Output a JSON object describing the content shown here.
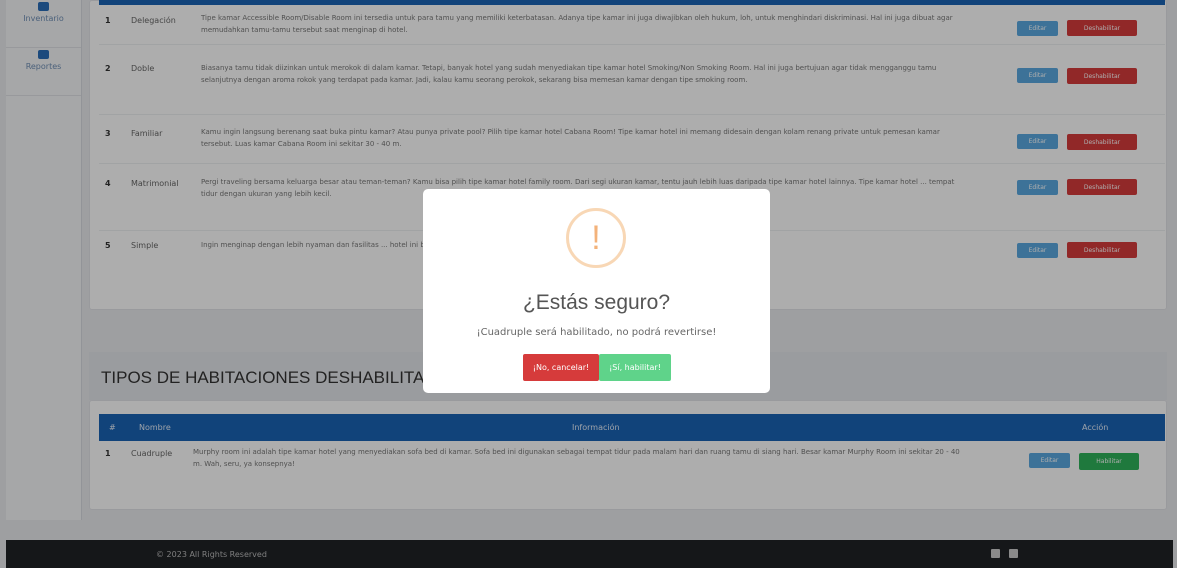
{
  "sidebar": {
    "items": [
      {
        "label": "Inventario",
        "icon": "box-icon"
      },
      {
        "label": "Reportes",
        "icon": "report-icon"
      }
    ]
  },
  "enabled_rooms": [
    {
      "num": "1",
      "name": "Delegación",
      "info": "Tipe kamar Accessible Room/Disable Room ini tersedia untuk para tamu yang memiliki keterbatasan. Adanya tipe kamar ini juga diwajibkan oleh hukum, loh, untuk menghindari diskriminasi. Hal ini juga dibuat agar memudahkan tamu-tamu tersebut saat menginap di hotel.",
      "edit": "Editar",
      "disable": "Deshabilitar"
    },
    {
      "num": "2",
      "name": "Doble",
      "info": "Biasanya tamu tidak diizinkan untuk merokok di dalam kamar. Tetapi, banyak hotel yang sudah menyediakan tipe kamar hotel Smoking/Non Smoking Room. Hal ini juga bertujuan agar tidak mengganggu tamu selanjutnya dengan aroma rokok yang terdapat pada kamar. Jadi, kalau kamu seorang perokok, sekarang bisa memesan kamar dengan tipe smoking room.",
      "edit": "Editar",
      "disable": "Deshabilitar"
    },
    {
      "num": "3",
      "name": "Familiar",
      "info": "Kamu ingin langsung berenang saat buka pintu kamar? Atau punya private pool? Pilih tipe kamar hotel Cabana Room! Tipe kamar hotel ini memang didesain dengan kolam renang private untuk pemesan kamar tersebut. Luas kamar Cabana Room ini sekitar 30 - 40 m.",
      "edit": "Editar",
      "disable": "Deshabilitar"
    },
    {
      "num": "4",
      "name": "Matrimonial",
      "info": "Pergi traveling bersama keluarga besar atau teman-teman? Kamu bisa pilih tipe kamar hotel family room. Dari segi ukuran kamar, tentu jauh lebih luas daripada tipe kamar hotel lainnya. Tipe kamar hotel ... tempat tidur dengan ukuran yang lebih kecil.",
      "edit": "Editar",
      "disable": "Deshabilitar"
    },
    {
      "num": "5",
      "name": "Simple",
      "info": "Ingin menginap dengan lebih nyaman dan fasilitas ... hotel ini biasanya memiliki ukuran kasur yang besar seperti king size. ... ndu.",
      "edit": "Editar",
      "disable": "Deshabilitar"
    }
  ],
  "disabled_section": {
    "title": "TIPOS DE HABITACIONES DESHABILITADOS",
    "headers": {
      "num": "#",
      "name": "Nombre",
      "info": "Información",
      "action": "Acción"
    },
    "rows": [
      {
        "num": "1",
        "name": "Cuadruple",
        "info": "Murphy room ini adalah tipe kamar hotel yang menyediakan sofa bed di kamar. Sofa bed ini digunakan sebagai tempat tidur pada malam hari dan ruang tamu di siang hari. Besar kamar Murphy Room ini sekitar 20 - 40 m. Wah, seru, ya konsepnya!",
        "edit": "Editar",
        "enable": "Habilitar"
      }
    ]
  },
  "modal": {
    "icon": "!",
    "title": "¿Estás seguro?",
    "text": "¡Cuadruple será habilitado, no podrá revertirse!",
    "cancel": "¡No, cancelar!",
    "confirm": "¡Sí, habilitar!"
  },
  "footer": {
    "copyright": "© 2023 All Rights Reserved",
    "icons": [
      "facebook-icon",
      "share-icon"
    ]
  },
  "colors": {
    "primary": "#1a64b4",
    "danger": "#d63b3b",
    "success": "#2fb35a",
    "info": "#5aa8e0",
    "warning_ring": "#f8d7b5"
  }
}
